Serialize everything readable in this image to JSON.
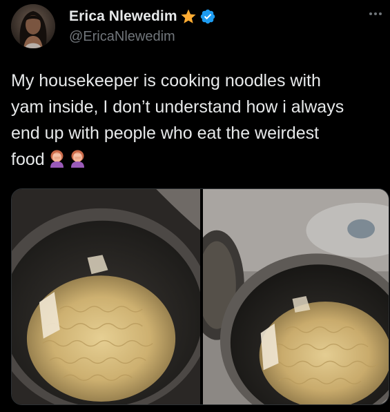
{
  "author": {
    "display_name": "Erica Nlewedim",
    "handle": "@EricaNlewedim",
    "avatar_icon": "profile-photo",
    "badge_star_icon": "star-emoji-icon",
    "badge_verified_icon": "verified-badge-icon"
  },
  "more_icon": "more-dots-icon",
  "tweet": {
    "text_line1": "My housekeeper is cooking noodles with",
    "text_line2": "yam inside, I don’t understand how i always",
    "text_line3": "end up with people who eat the weirdest",
    "text_line4": "food",
    "emojis": [
      "woman-facepalming-emoji",
      "woman-facepalming-emoji"
    ]
  },
  "media": {
    "photo_count": 2,
    "photos": [
      "noodles-with-yam-in-pot-photo",
      "noodles-in-pot-on-stove-photo"
    ]
  },
  "colors": {
    "background": "#000000",
    "text_primary": "#e7e9ea",
    "text_secondary": "#71767b",
    "verified_blue": "#1d9bf0",
    "star_gold": "#ffac33"
  }
}
